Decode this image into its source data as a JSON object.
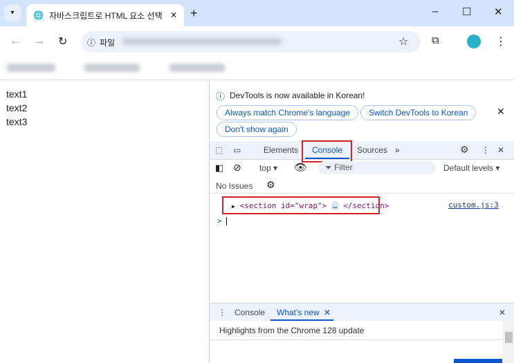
{
  "browser": {
    "tab_title": "자바스크립트로 HTML 요소 선택",
    "address_scheme": "파일",
    "window_controls": {
      "minimize": "–",
      "maximize": "☐",
      "close": "✕"
    }
  },
  "page": {
    "lines": [
      "text1",
      "text2",
      "text3"
    ]
  },
  "devtools": {
    "infobar": {
      "message": "DevTools is now available in Korean!",
      "buttons": [
        "Always match Chrome's language",
        "Switch DevTools to Korean",
        "Don't show again"
      ]
    },
    "tabs": [
      "Elements",
      "Console",
      "Sources"
    ],
    "active_tab": "Console",
    "more_tabs": "»",
    "console_toolbar": {
      "context": "top ▾",
      "filter_placeholder": "Filter",
      "levels": "Default levels ▾"
    },
    "issues": "No Issues",
    "log": {
      "open_tag": "<section id=\"wrap\">",
      "ellipsis": "…",
      "close_tag": "</section>",
      "source": "custom.js:3"
    },
    "prompt": ">",
    "drawer": {
      "tabs": [
        "Console",
        "What's new"
      ],
      "active": "What's new",
      "headline": "Highlights from the Chrome 128 update"
    }
  },
  "colors": {
    "accent": "#0b57d0",
    "highlight": "#d3222a"
  }
}
